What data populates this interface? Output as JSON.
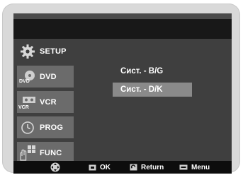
{
  "sidebar": {
    "items": [
      {
        "label": "SETUP",
        "icon": "gear-icon"
      },
      {
        "label": "DVD",
        "icon": "dvd-icon"
      },
      {
        "label": "VCR",
        "icon": "vcr-icon"
      },
      {
        "label": "PROG",
        "icon": "clock-icon"
      },
      {
        "label": "FUNC",
        "icon": "hand-menu-icon"
      }
    ],
    "icon_texts": {
      "dvd": "DVD",
      "vcr": "VCR"
    }
  },
  "menu": {
    "options": [
      "Сист. - B/G",
      "Сист. - D/K"
    ],
    "selected": "Сист. - D/K"
  },
  "footer": {
    "ok_label": "OK",
    "return_label": "Return",
    "menu_label": "Menu",
    "nav_icon": "dpad-icon"
  },
  "colors": {
    "frame": "#d9d9d9",
    "screen": "#3f3f3f",
    "header": "#181818",
    "sidebar_item": "#6b6b6b",
    "selected_option": "#8a8a8a",
    "footer": "#0d0d0d"
  }
}
